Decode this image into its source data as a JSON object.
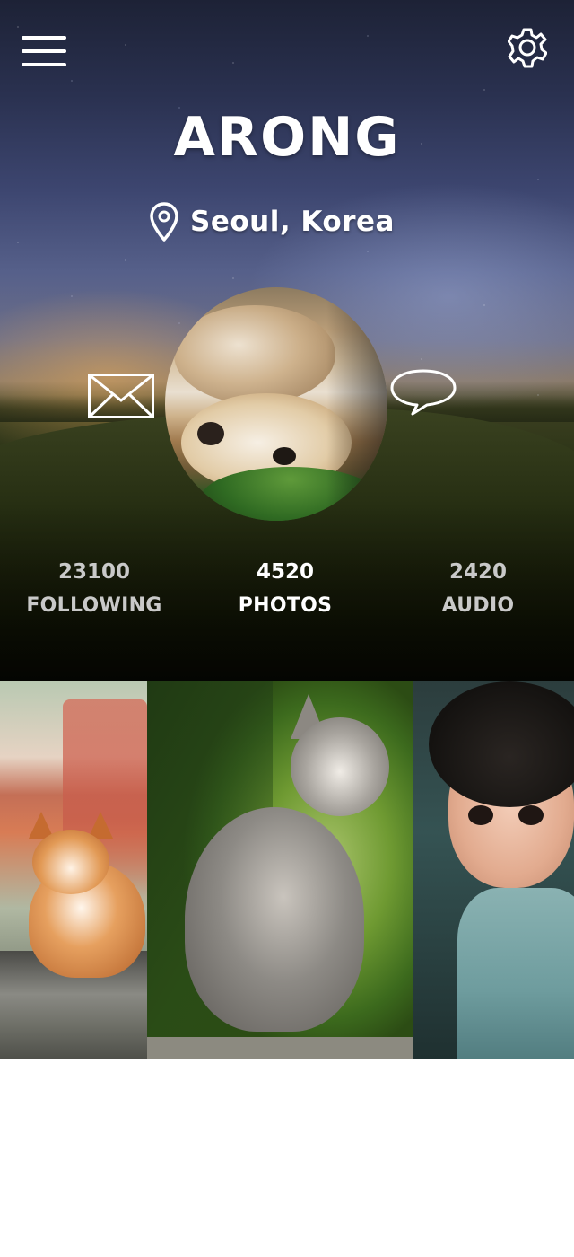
{
  "header": {
    "menu_icon": "hamburger-menu-icon",
    "settings_icon": "gear-icon"
  },
  "profile": {
    "name": "ARONG",
    "location": "Seoul, Korea",
    "location_icon": "map-pin-icon"
  },
  "actions": {
    "message_icon": "envelope-icon",
    "chat_icon": "speech-bubble-icon"
  },
  "stats": [
    {
      "value": "23100",
      "label": "FOLLOWING",
      "active": false
    },
    {
      "value": "4520",
      "label": "PHOTOS",
      "active": true
    },
    {
      "value": "2420",
      "label": "AUDIO",
      "active": false
    }
  ],
  "gallery": {
    "items": [
      "corgi-photo",
      "kitten-photo",
      "child-photo"
    ]
  },
  "colors": {
    "text": "#ffffff",
    "inactive_stat": "#c9c9c9",
    "background": "#ffffff"
  }
}
